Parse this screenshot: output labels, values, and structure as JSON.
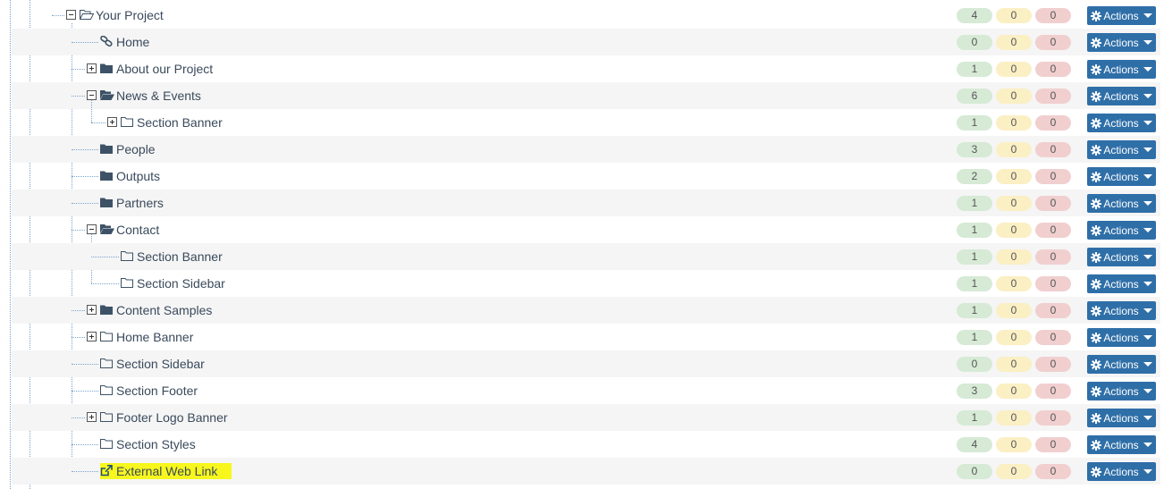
{
  "actions_label": "Actions",
  "colors": {
    "actions_bg": "#2f6fa8",
    "green_badge": "#d6ead6",
    "yellow_badge": "#fbefc4",
    "red_badge": "#f1cfcf",
    "highlight": "#f7f71e",
    "tree_line": "#7ba3cc"
  },
  "rows": [
    {
      "label": "Your Project",
      "icon": "folder-open-outline-icon",
      "depth": 0,
      "toggle": "minus",
      "counts": [
        "4",
        "0",
        "0"
      ]
    },
    {
      "label": "Home",
      "icon": "link-icon",
      "depth": 1,
      "toggle": null,
      "counts": [
        "0",
        "0",
        "0"
      ]
    },
    {
      "label": "About our Project",
      "icon": "folder-solid-icon",
      "depth": 1,
      "toggle": "plus",
      "counts": [
        "1",
        "0",
        "0"
      ]
    },
    {
      "label": "News & Events",
      "icon": "folder-open-solid-icon",
      "depth": 1,
      "toggle": "minus",
      "counts": [
        "6",
        "0",
        "0"
      ]
    },
    {
      "label": "Section Banner",
      "icon": "folder-outline-icon",
      "depth": 2,
      "toggle": "plus",
      "counts": [
        "1",
        "0",
        "0"
      ]
    },
    {
      "label": "People",
      "icon": "folder-solid-icon",
      "depth": 1,
      "toggle": null,
      "counts": [
        "3",
        "0",
        "0"
      ]
    },
    {
      "label": "Outputs",
      "icon": "folder-solid-icon",
      "depth": 1,
      "toggle": null,
      "counts": [
        "2",
        "0",
        "0"
      ]
    },
    {
      "label": "Partners",
      "icon": "folder-solid-icon",
      "depth": 1,
      "toggle": null,
      "counts": [
        "1",
        "0",
        "0"
      ]
    },
    {
      "label": "Contact",
      "icon": "folder-open-solid-icon",
      "depth": 1,
      "toggle": "minus",
      "counts": [
        "1",
        "0",
        "0"
      ]
    },
    {
      "label": "Section Banner",
      "icon": "folder-outline-icon",
      "depth": 2,
      "toggle": null,
      "counts": [
        "1",
        "0",
        "0"
      ]
    },
    {
      "label": "Section Sidebar",
      "icon": "folder-outline-icon",
      "depth": 2,
      "toggle": null,
      "counts": [
        "1",
        "0",
        "0"
      ]
    },
    {
      "label": "Content Samples",
      "icon": "folder-solid-icon",
      "depth": 1,
      "toggle": "plus",
      "counts": [
        "1",
        "0",
        "0"
      ]
    },
    {
      "label": "Home Banner",
      "icon": "folder-outline-icon",
      "depth": 1,
      "toggle": "plus",
      "counts": [
        "1",
        "0",
        "0"
      ]
    },
    {
      "label": "Section Sidebar",
      "icon": "folder-outline-icon",
      "depth": 1,
      "toggle": null,
      "counts": [
        "0",
        "0",
        "0"
      ]
    },
    {
      "label": "Section Footer",
      "icon": "folder-outline-icon",
      "depth": 1,
      "toggle": null,
      "counts": [
        "3",
        "0",
        "0"
      ]
    },
    {
      "label": "Footer Logo Banner",
      "icon": "folder-outline-icon",
      "depth": 1,
      "toggle": "plus",
      "counts": [
        "1",
        "0",
        "0"
      ]
    },
    {
      "label": "Section Styles",
      "icon": "folder-outline-icon",
      "depth": 1,
      "toggle": null,
      "counts": [
        "4",
        "0",
        "0"
      ]
    },
    {
      "label": "External Web Link",
      "icon": "external-link-icon",
      "depth": 1,
      "toggle": null,
      "counts": [
        "0",
        "0",
        "0"
      ],
      "highlighted": true
    }
  ]
}
